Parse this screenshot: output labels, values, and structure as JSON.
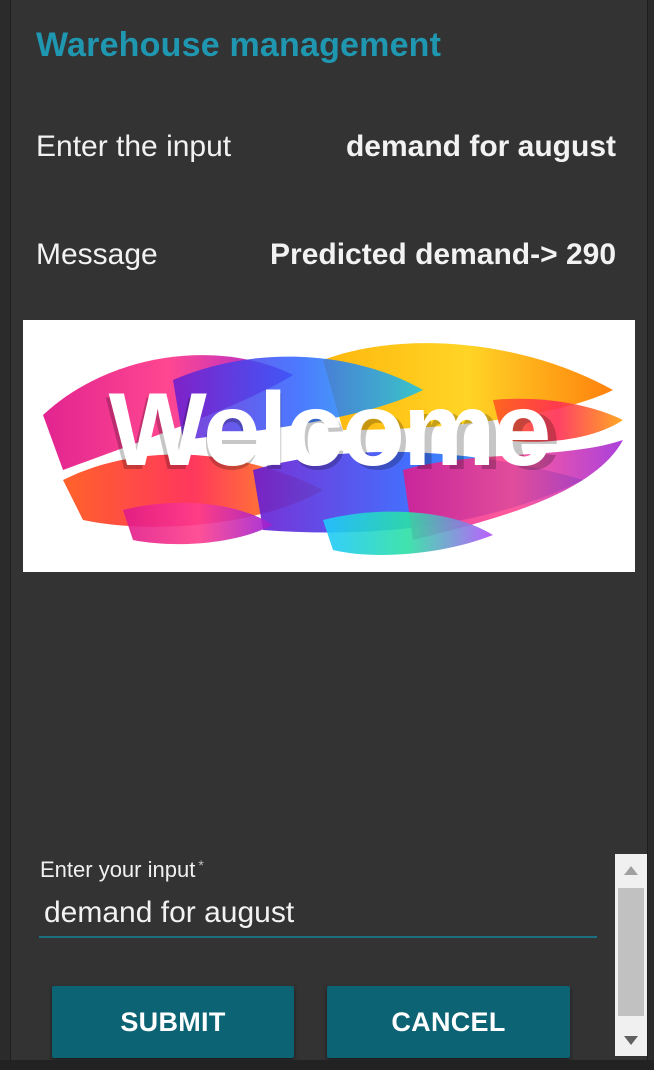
{
  "app": {
    "title": "Warehouse management"
  },
  "rows": [
    {
      "label": "Enter the input",
      "value": "demand for august"
    },
    {
      "label": "Message",
      "value": "Predicted demand-> 290"
    }
  ],
  "banner": {
    "text": "Welcome",
    "icon": "welcome-banner-image"
  },
  "form": {
    "label": "Enter your input",
    "required_mark": "*",
    "value": "demand for august"
  },
  "buttons": {
    "submit": "SUBMIT",
    "cancel": "CANCEL"
  },
  "colors": {
    "title": "#1f97b1",
    "button": "#0b6373",
    "background": "#333333",
    "underline": "#1b6f80"
  }
}
